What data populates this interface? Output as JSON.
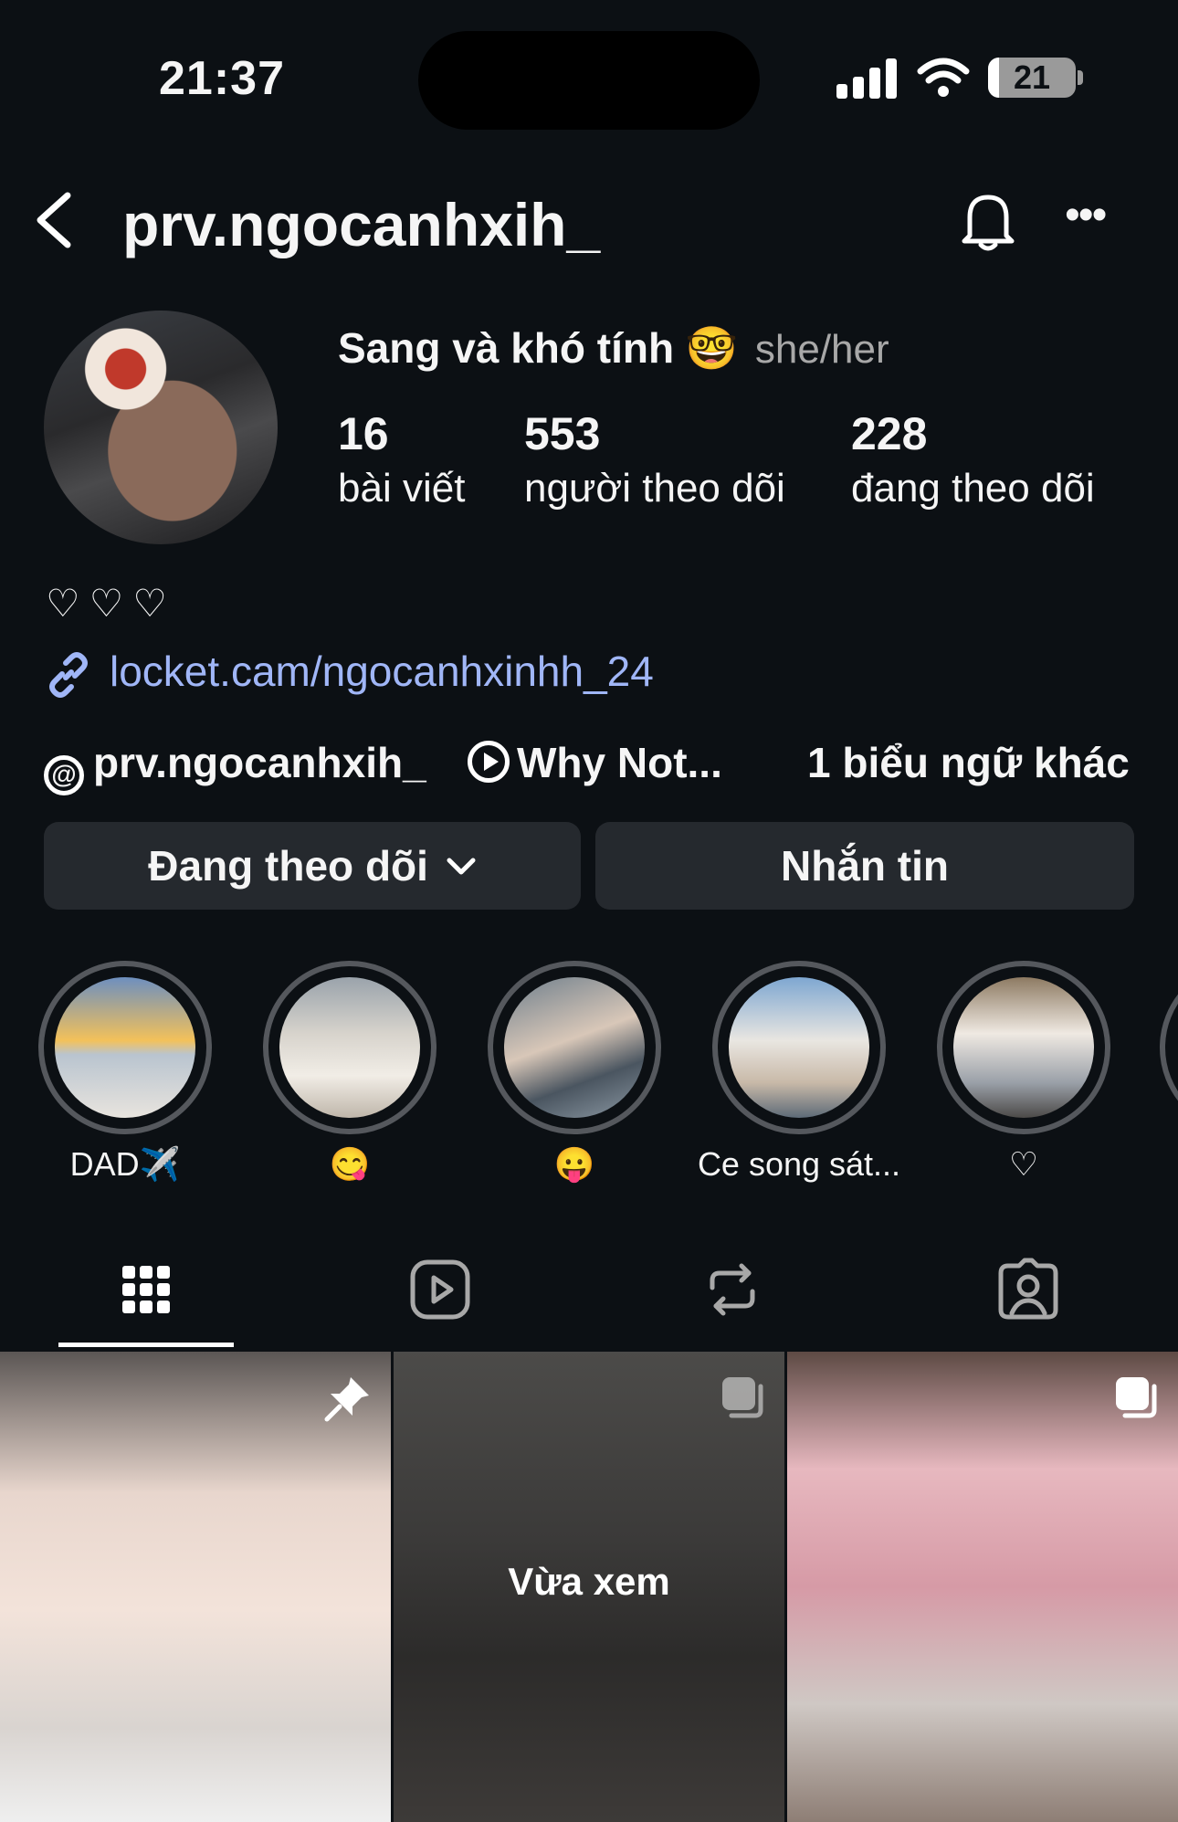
{
  "status_bar": {
    "time": "21:37",
    "battery": "21"
  },
  "header": {
    "username": "prv.ngocanhxih_"
  },
  "profile": {
    "display_name": "Sang và khó tính",
    "emoji": "🤓",
    "pronouns": "she/her",
    "stats": [
      {
        "value": "16",
        "label": "bài viết"
      },
      {
        "value": "553",
        "label": "người theo dõi"
      },
      {
        "value": "228",
        "label": "đang theo dõi"
      }
    ],
    "bio": "♡♡♡",
    "link": "locket.cam/ngocanhxinhh_24",
    "threads_handle": "prv.ngocanhxih_",
    "music": "Why Not...",
    "banners": "1 biểu ngữ khác"
  },
  "buttons": {
    "following": "Đang theo dõi",
    "message": "Nhắn tin"
  },
  "highlights": [
    {
      "label": "DAD✈️"
    },
    {
      "label": "😋"
    },
    {
      "label": "😛"
    },
    {
      "label": "Ce song sát..."
    },
    {
      "label": "♡"
    }
  ],
  "grid": {
    "overlay_text": "Vừa xem"
  }
}
